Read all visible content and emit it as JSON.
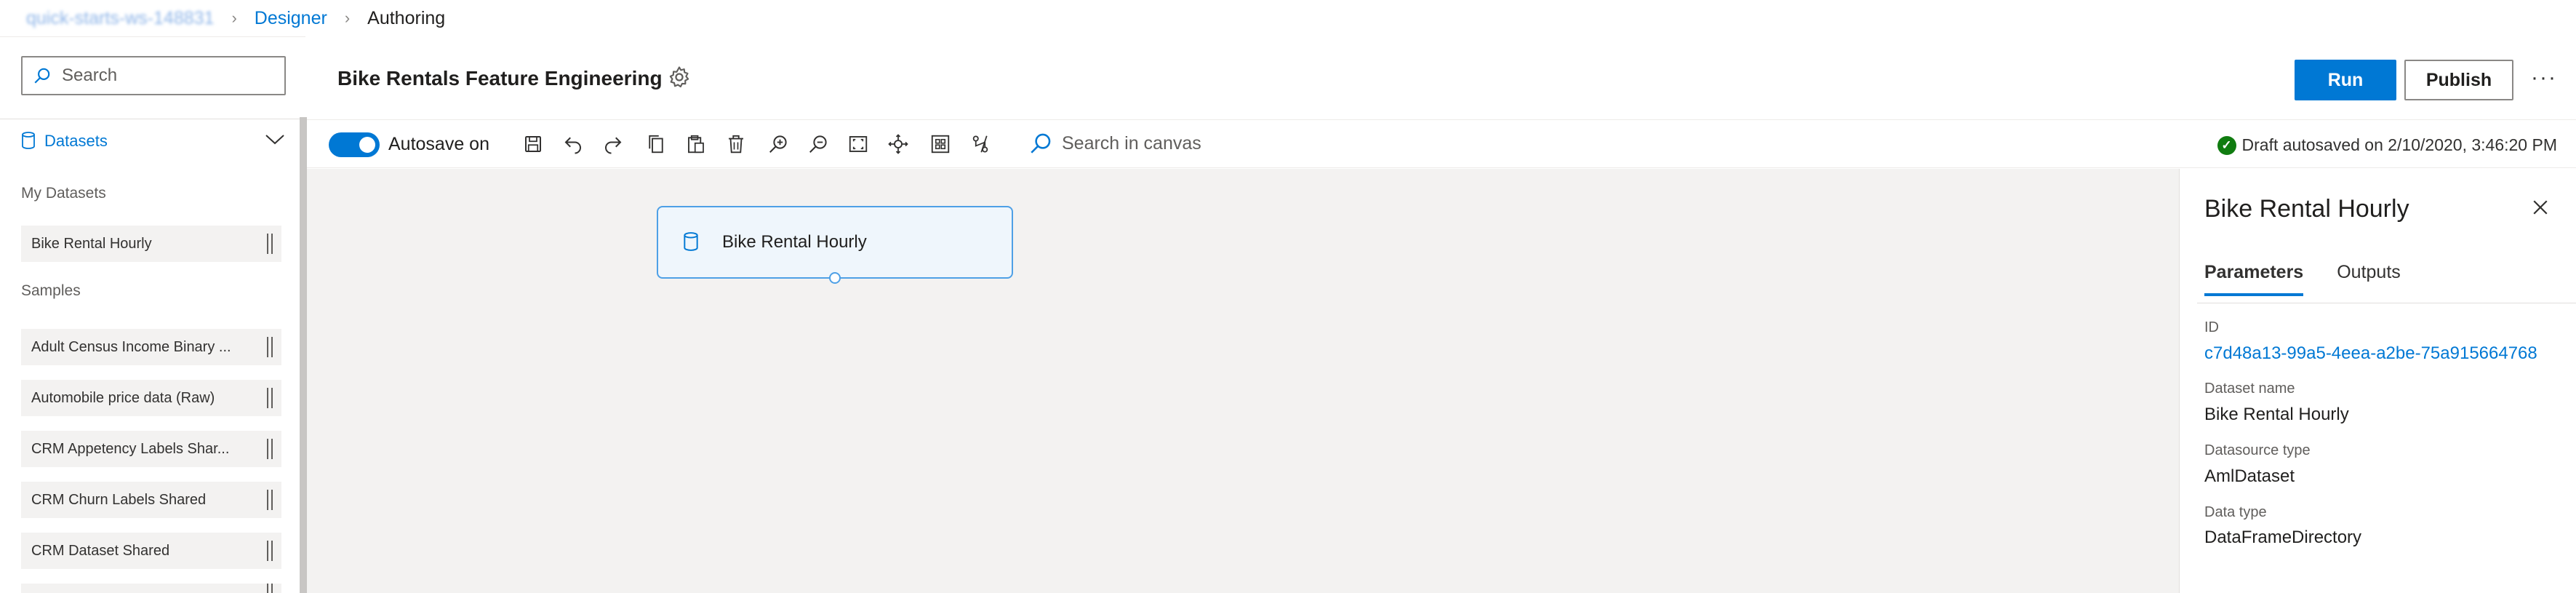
{
  "breadcrumb": {
    "workspace": "quick-starts-ws-148831",
    "designer": "Designer",
    "current": "Authoring"
  },
  "left_panel": {
    "search_placeholder": "Search",
    "datasets_header": "Datasets",
    "my_datasets_title": "My Datasets",
    "my_datasets": [
      "Bike Rental Hourly"
    ],
    "samples_title": "Samples",
    "samples": [
      "Adult Census Income Binary ...",
      "Automobile price data (Raw)",
      "CRM Appetency Labels Shar...",
      "CRM Churn Labels Shared",
      "CRM Dataset Shared"
    ]
  },
  "header": {
    "pipeline_title": "Bike Rentals Feature Engineering",
    "run_label": "Run",
    "publish_label": "Publish",
    "more_label": "···"
  },
  "toolbar": {
    "autosave_label": "Autosave on",
    "canvas_search_placeholder": "Search in canvas",
    "draft_status": "Draft autosaved on 2/10/2020, 3:46:20 PM"
  },
  "canvas": {
    "node_name": "Bike Rental Hourly"
  },
  "details_panel": {
    "title": "Bike Rental Hourly",
    "tabs": [
      "Parameters",
      "Outputs"
    ],
    "fields": [
      {
        "label": "ID",
        "value": "c7d48a13-99a5-4eea-a2be-75a915664768"
      },
      {
        "label": "Dataset name",
        "value": "Bike Rental Hourly"
      },
      {
        "label": "Datasource type",
        "value": "AmlDataset"
      },
      {
        "label": "Data type",
        "value": "DataFrameDirectory"
      }
    ]
  },
  "colors": {
    "accent": "#0078d4",
    "canvas_bg": "#f3f2f1",
    "success": "#107c10"
  }
}
